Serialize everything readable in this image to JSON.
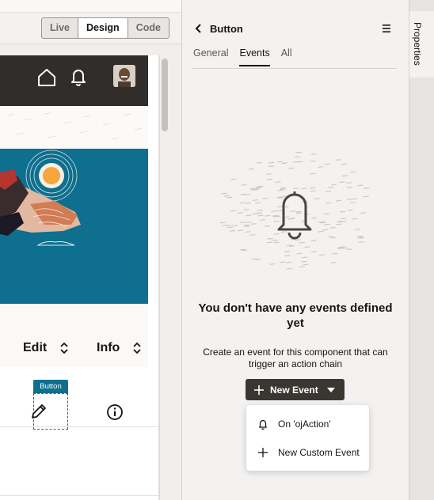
{
  "mode_switch": {
    "live": "Live",
    "design": "Design",
    "code": "Code",
    "active": "Design"
  },
  "canvas": {
    "edit_label": "Edit",
    "info_label": "Info",
    "selected_tag": "Button"
  },
  "panel": {
    "title": "Button",
    "tabs": [
      {
        "label": "General",
        "active": false
      },
      {
        "label": "Events",
        "active": true
      },
      {
        "label": "All",
        "active": false
      }
    ],
    "empty_title": "You don't have any events defined yet",
    "empty_desc": "Create an event for this component that can trigger an action chain",
    "new_event_label": "New Event",
    "dropdown": [
      {
        "label": "On 'ojAction'",
        "icon": "bell-icon"
      },
      {
        "label": "New Custom Event",
        "icon": "plus-icon"
      }
    ]
  },
  "rail": {
    "label": "Properties"
  },
  "colors": {
    "header_dark": "#312d2a",
    "hero_teal": "#0e6f8e",
    "button_dark": "#3a3632",
    "panel_bg": "#f4f2f0"
  }
}
